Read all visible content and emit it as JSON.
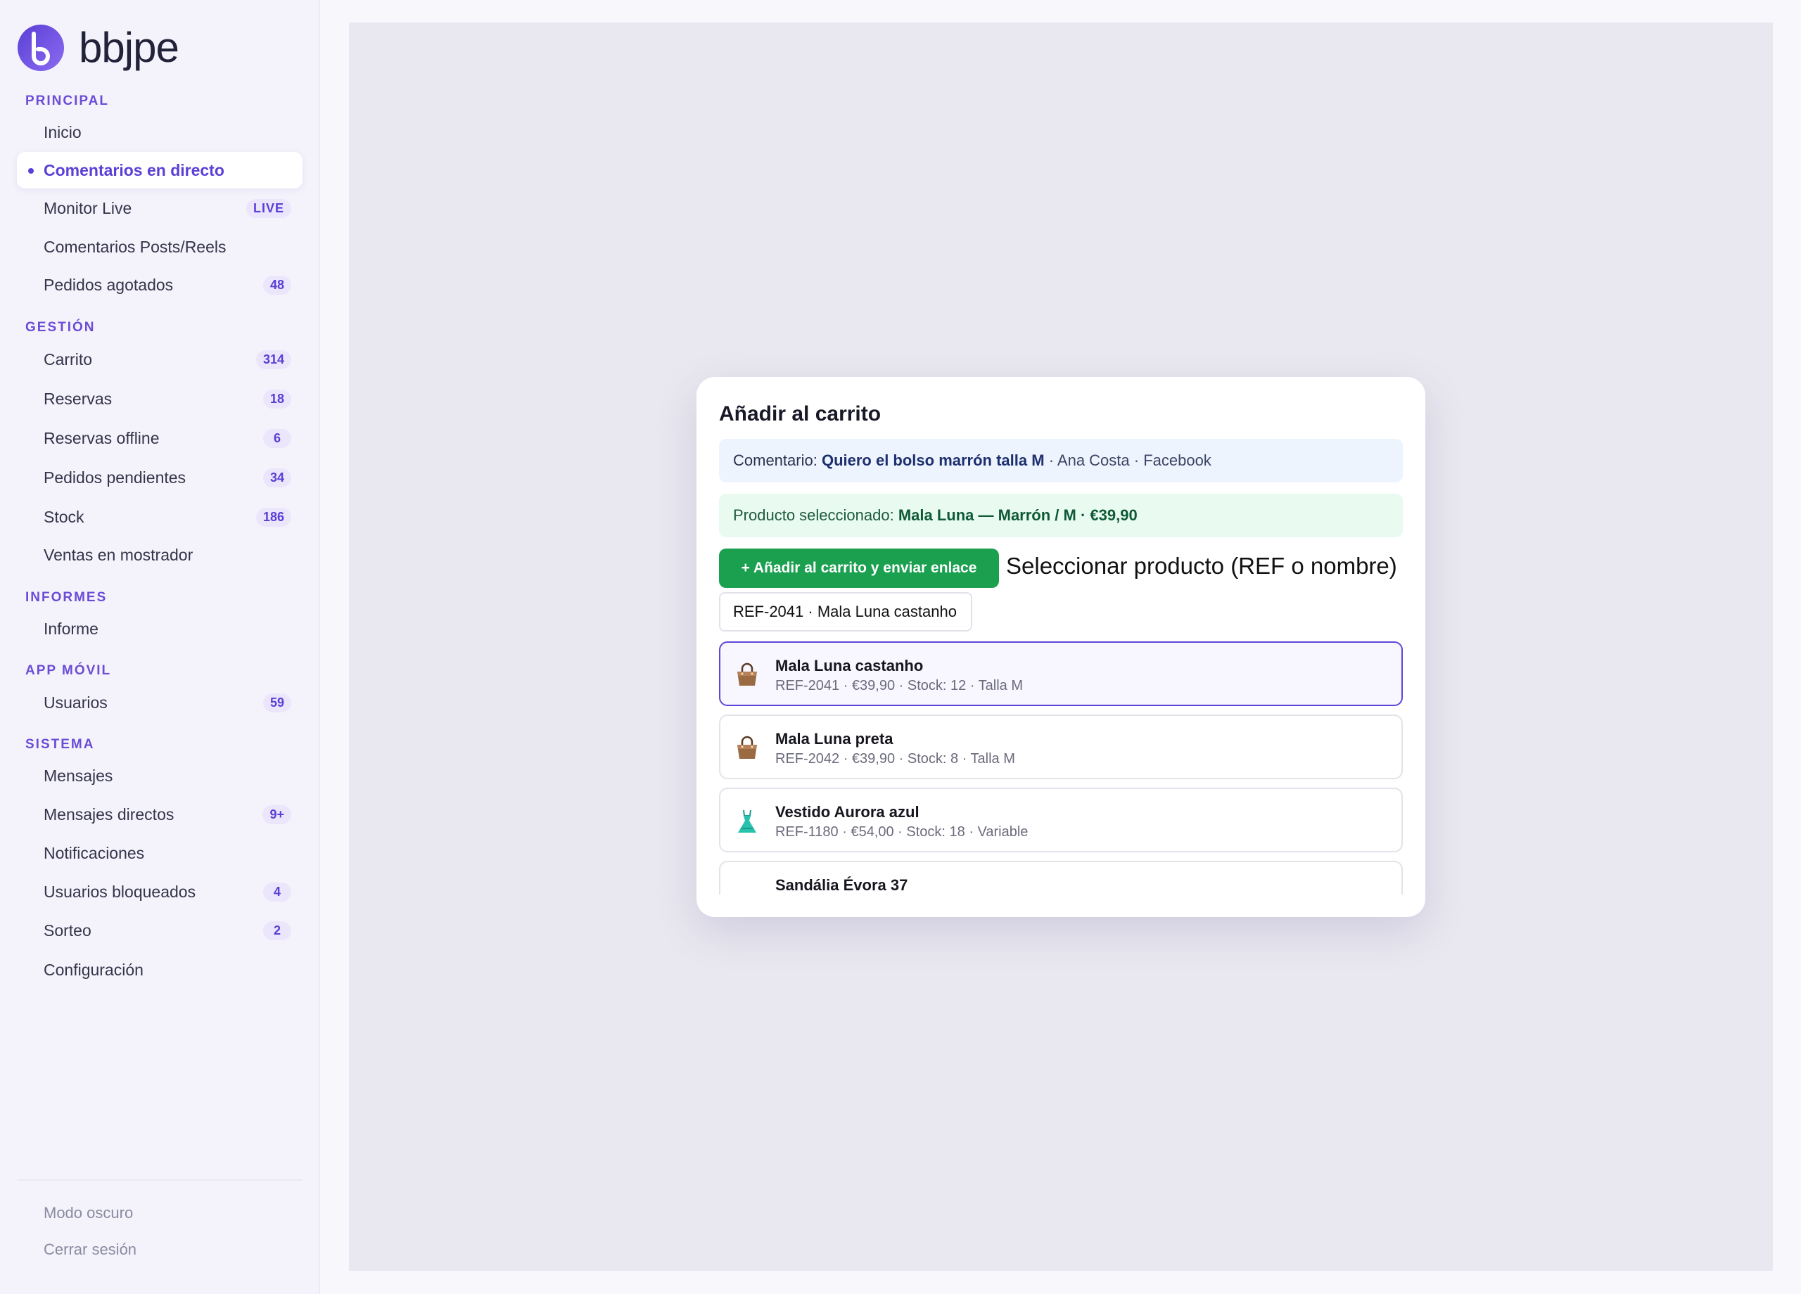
{
  "brand": {
    "name": "bbjpe",
    "accent": "#6b4cd6"
  },
  "sidebar": {
    "sections": [
      {
        "title": "PRINCIPAL",
        "items": [
          {
            "label": "Inicio",
            "badge": ""
          },
          {
            "label": "Comentarios en directo",
            "badge": "",
            "active": true
          },
          {
            "label": "Monitor Live",
            "badge": "LIVE"
          },
          {
            "label": "Comentarios Posts/Reels",
            "badge": ""
          },
          {
            "label": "Pedidos agotados",
            "badge": "48"
          }
        ]
      },
      {
        "title": "GESTIÓN",
        "items": [
          {
            "label": "Carrito",
            "badge": "314"
          },
          {
            "label": "Reservas",
            "badge": "18"
          },
          {
            "label": "Reservas offline",
            "badge": "6"
          },
          {
            "label": "Pedidos pendientes",
            "badge": "34"
          },
          {
            "label": "Stock",
            "badge": "186"
          },
          {
            "label": "Ventas en mostrador",
            "badge": ""
          }
        ]
      },
      {
        "title": "INFORMES",
        "items": [
          {
            "label": "Informe",
            "badge": ""
          }
        ]
      },
      {
        "title": "APP MÓVIL",
        "items": [
          {
            "label": "Usuarios",
            "badge": "59"
          }
        ]
      },
      {
        "title": "SISTEMA",
        "items": [
          {
            "label": "Mensajes",
            "badge": ""
          },
          {
            "label": "Mensajes directos",
            "badge": "9+"
          },
          {
            "label": "Notificaciones",
            "badge": ""
          },
          {
            "label": "Usuarios bloqueados",
            "badge": "4"
          },
          {
            "label": "Sorteo",
            "badge": "2"
          },
          {
            "label": "Configuración",
            "badge": ""
          }
        ]
      }
    ],
    "footer": {
      "dark_mode": "Modo oscuro",
      "logout": "Cerrar sesión"
    }
  },
  "modal": {
    "title": "Añadir al carrito",
    "comment": {
      "prefix": "Comentario: ",
      "text": "Quiero el bolso marrón talla M",
      "meta": " · Ana Costa · Facebook"
    },
    "selected_product": {
      "prefix": "Producto seleccionado: ",
      "text": "Mala Luna — Marrón / M · €39,90"
    },
    "add_button": "+ Añadir al carrito y enviar enlace",
    "select_label": "Seleccionar producto (REF o nombre)",
    "search_value": "REF-2041 · Mala Luna castanho",
    "results": [
      {
        "name": "Mala Luna castanho",
        "meta": "REF-2041 · €39,90 · Stock: 12 · Talla M",
        "icon": "handbag-icon",
        "selected": true
      },
      {
        "name": "Mala Luna preta",
        "meta": "REF-2042 · €39,90 · Stock: 8 · Talla M",
        "icon": "handbag-icon"
      },
      {
        "name": "Vestido Aurora azul",
        "meta": "REF-1180 · €54,00 · Stock: 18 · Variable",
        "icon": "dress-icon"
      },
      {
        "name": "Sandália Évora 37",
        "meta": "",
        "icon": "sandal-icon"
      }
    ]
  }
}
